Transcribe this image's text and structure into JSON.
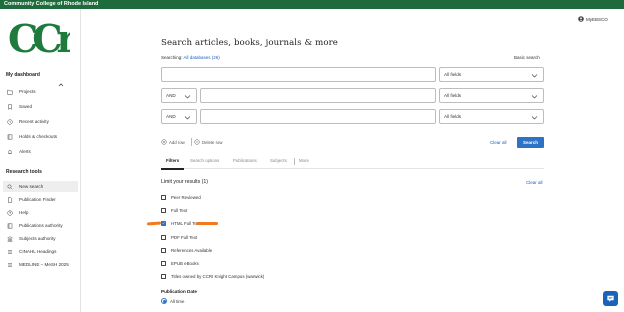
{
  "header": {
    "title": "Community College of Rhode Island"
  },
  "user_menu": {
    "label": "MyEBSCO"
  },
  "sidebar": {
    "dashboard_heading": "My dashboard",
    "dashboard_items": [
      {
        "label": "Projects",
        "icon": "folder-icon"
      },
      {
        "label": "Saved",
        "icon": "bookmark-icon"
      },
      {
        "label": "Recent activity",
        "icon": "history-icon"
      },
      {
        "label": "Holds & checkouts",
        "icon": "book-icon"
      },
      {
        "label": "Alerts",
        "icon": "bell-icon"
      }
    ],
    "tools_heading": "Research tools",
    "tools_items": [
      {
        "label": "New search",
        "icon": "search-icon",
        "active": true
      },
      {
        "label": "Publication Finder",
        "icon": "document-icon"
      },
      {
        "label": "Help",
        "icon": "help-icon"
      },
      {
        "label": "Publications authority",
        "icon": "book-icon"
      },
      {
        "label": "Subjects authority",
        "icon": "building-icon"
      },
      {
        "label": "CINAHL Headings",
        "icon": "list-icon"
      },
      {
        "label": "MEDLINE – MeSH 2025",
        "icon": "list-icon"
      }
    ]
  },
  "main": {
    "title": "Search articles, books, journals & more",
    "searching_label": "Searching:",
    "searching_db": "All databases (26)",
    "basic_search": "Basic search",
    "rows": [
      {
        "operator": "",
        "field": "All fields"
      },
      {
        "operator": "AND",
        "field": "All fields"
      },
      {
        "operator": "AND",
        "field": "All fields"
      }
    ],
    "add_row": "Add row",
    "delete_row": "Delete row",
    "clear_all": "Clear all",
    "search_button": "Search",
    "tabs": [
      "Filters",
      "Search options",
      "Publications",
      "Subjects",
      "More"
    ],
    "limit_title": "Limit your results (1)",
    "limit_clear": "Clear all",
    "limits": [
      {
        "label": "Peer Reviewed",
        "checked": false
      },
      {
        "label": "Full Text",
        "checked": false
      },
      {
        "label": "HTML Full Text",
        "checked": true
      },
      {
        "label": "PDF Full Text",
        "checked": false
      },
      {
        "label": "References Available",
        "checked": false
      },
      {
        "label": "EPUB eBooks",
        "checked": false
      },
      {
        "label": "Titles owned by CCRI Knight Campus (warwick)",
        "checked": false
      }
    ],
    "publication_date_heading": "Publication Date",
    "publication_date_option": "All time"
  },
  "colors": {
    "brand_green": "#1f6b3d",
    "accent_blue": "#2d72c4",
    "annotation_orange": "#f07a22"
  }
}
